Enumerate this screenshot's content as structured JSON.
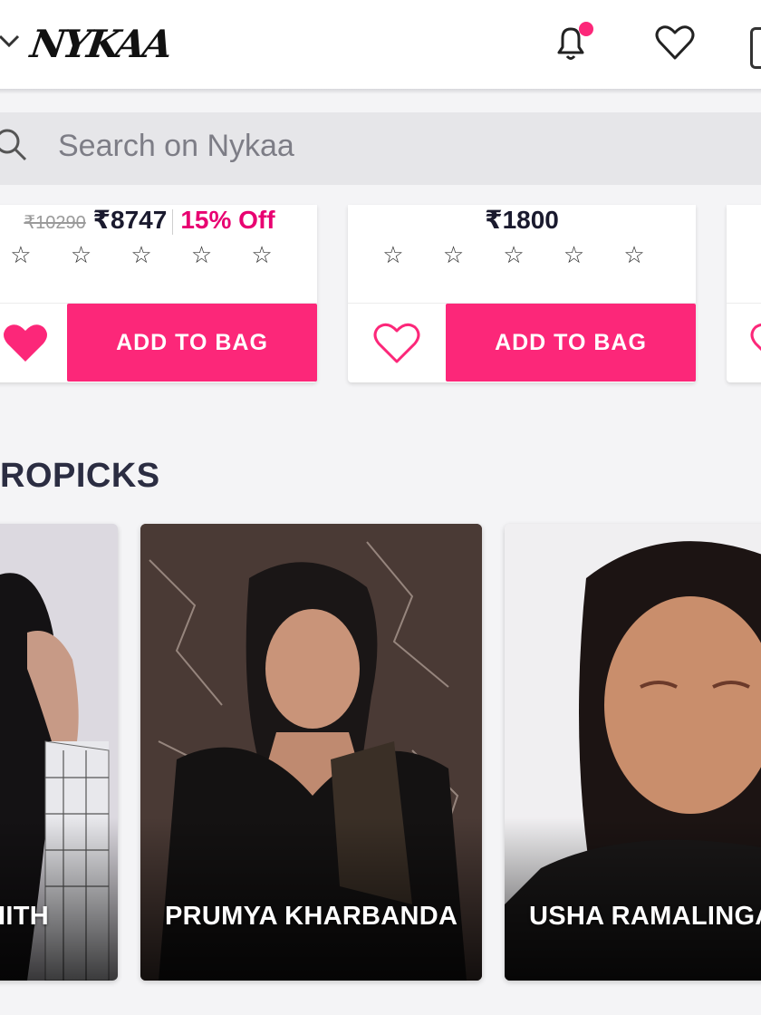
{
  "header": {
    "logo": "NYKAA",
    "icons": [
      "chevron-down-icon",
      "bell-icon",
      "heart-icon",
      "bag-icon"
    ],
    "notification_dot_color": "#fc2779"
  },
  "search": {
    "placeholder": "Search on Nykaa"
  },
  "products": [
    {
      "mrp": "₹10290",
      "price": "₹8747",
      "discount": "15% Off",
      "stars": "☆ ☆ ☆ ☆ ☆",
      "wishlisted": true,
      "add_label": "ADD TO BAG"
    },
    {
      "mrp": "",
      "price": "₹1800",
      "discount": "",
      "stars": "☆ ☆ ☆ ☆ ☆",
      "wishlisted": false,
      "add_label": "ADD TO BAG"
    }
  ],
  "section": {
    "title": "ROPICKS"
  },
  "creators": [
    {
      "name": "IITH"
    },
    {
      "name": "PRUMYA KHARBANDA"
    },
    {
      "name": "USHA RAMALINGA"
    }
  ],
  "colors": {
    "brand_pink": "#fc2779",
    "accent_pink": "#e80071"
  }
}
